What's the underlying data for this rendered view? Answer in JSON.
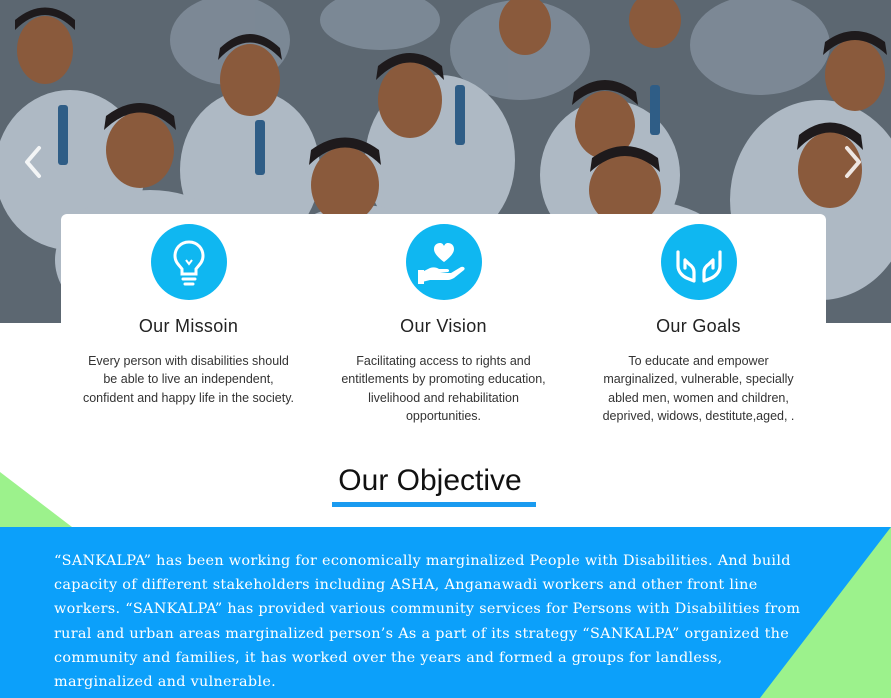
{
  "hero": {
    "prev_icon": "chevron-left-icon",
    "next_icon": "chevron-right-icon"
  },
  "features": [
    {
      "icon": "lightbulb-icon",
      "title": "Our Missoin",
      "text": "Every person with disabilities should be able to live an independent, confident and happy life in the society."
    },
    {
      "icon": "heart-hand-icon",
      "title": "Our Vision",
      "text": "Facilitating access to rights and entitlements by promoting education, livelihood and rehabilitation opportunities."
    },
    {
      "icon": "caring-hands-icon",
      "title": "Our Goals",
      "text": "To educate and empower marginalized, vulnerable, specially abled men, women and children, deprived, widows, destitute,aged, ."
    }
  ],
  "objective": {
    "heading": "Our Objective",
    "body": "“SANKALPA” has been working for economically marginalized People with Disabilities. And build capacity of different stakeholders including ASHA, Anganawadi workers and other front line workers. “SANKALPA” has provided various community services for Persons with Disabilities from rural and urban areas marginalized person’s As a part of its strategy “SANKALPA” organized the community and families, it has worked over the years and formed a groups for landless, marginalized and vulnerable."
  },
  "colors": {
    "accent_blue": "#0fb7f1",
    "band_blue": "#0ca0fa",
    "accent_green": "#9cf28c",
    "underline": "#1a9bf0"
  }
}
